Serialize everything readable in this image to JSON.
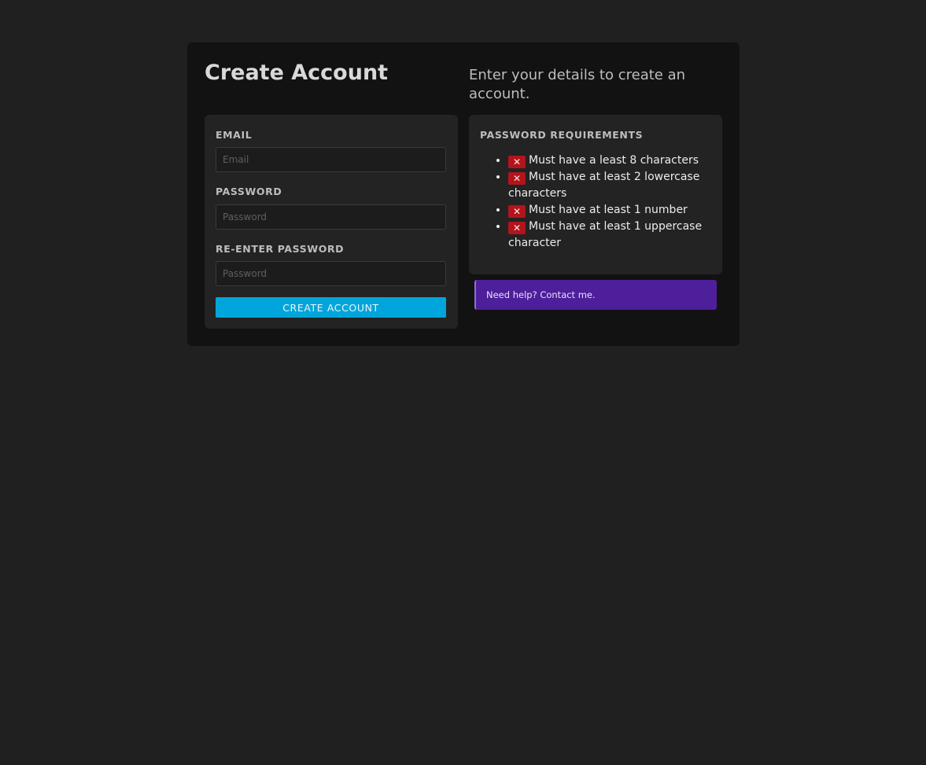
{
  "header": {
    "title": "Create Account",
    "subtitle": "Enter your details to create an account."
  },
  "form": {
    "email_label": "EMAIL",
    "email_placeholder": "Email",
    "email_value": "",
    "password_label": "PASSWORD",
    "password_placeholder": "Password",
    "password_value": "",
    "reenter_label": "RE-ENTER PASSWORD",
    "reenter_placeholder": "Password",
    "reenter_value": "",
    "submit_label": "CREATE ACCOUNT"
  },
  "requirements": {
    "title": "PASSWORD REQUIREMENTS",
    "status_symbol": "✕",
    "items": [
      {
        "text": "Must have a least 8 characters",
        "met": false
      },
      {
        "text": "Must have at least 2 lowercase characters",
        "met": false
      },
      {
        "text": "Must have at least 1 number",
        "met": false
      },
      {
        "text": "Must have at least 1 uppercase character",
        "met": false
      }
    ]
  },
  "help": {
    "text": "Need help? Contact me."
  },
  "colors": {
    "background": "#202020",
    "card": "#121212",
    "panel": "#232323",
    "accent_button": "#00a6db",
    "error_badge": "#b3141c",
    "help_bar": "#4e1f9b"
  },
  "icons": {
    "requirement_unmet": "close-icon"
  }
}
